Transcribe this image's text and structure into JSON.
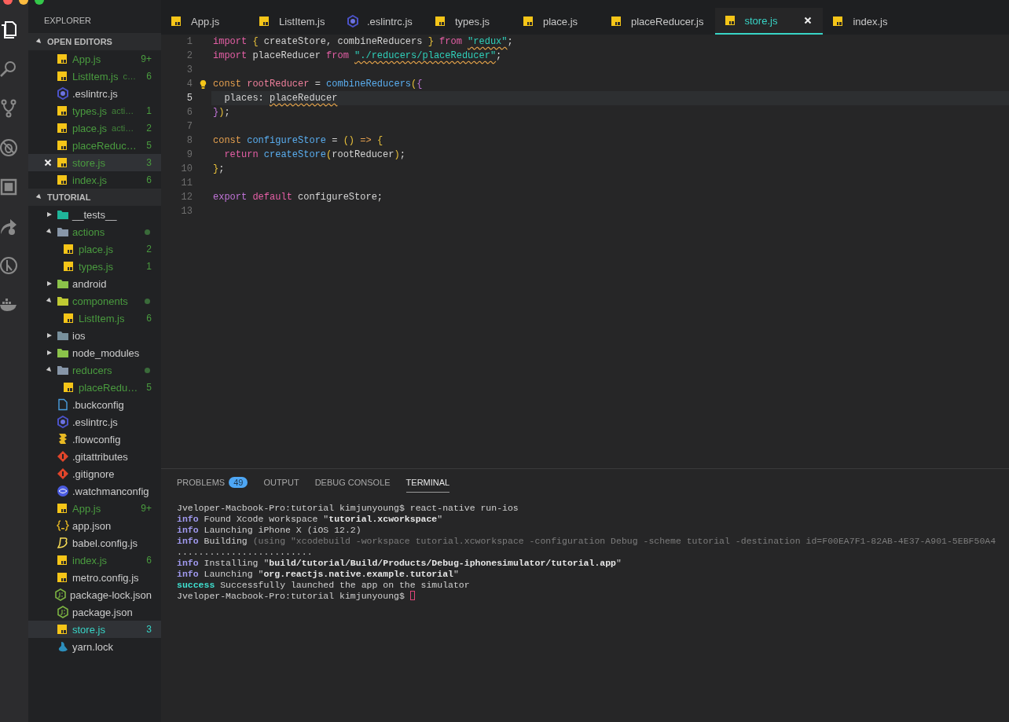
{
  "sidebar": {
    "title": "EXPLORER",
    "open_editors": {
      "title": "OPEN EDITORS",
      "expanded": true,
      "items": [
        {
          "name": "App.js",
          "kind": "js",
          "modified": true,
          "badge": "9+",
          "selected": false
        },
        {
          "name": "ListItem.js",
          "description": "c…",
          "kind": "js",
          "modified": true,
          "badge": "6",
          "selected": false
        },
        {
          "name": ".eslintrc.js",
          "kind": "eslint",
          "modified": false,
          "selected": false
        },
        {
          "name": "types.js",
          "description": "acti…",
          "kind": "js",
          "modified": true,
          "badge": "1",
          "selected": false
        },
        {
          "name": "place.js",
          "description": "acti…",
          "kind": "js",
          "modified": true,
          "badge": "2",
          "selected": false
        },
        {
          "name": "placeReduc…",
          "kind": "js",
          "modified": true,
          "badge": "5",
          "selected": false
        },
        {
          "name": "store.js",
          "kind": "js",
          "modified": true,
          "badge": "3",
          "selected": true
        },
        {
          "name": "index.js",
          "kind": "js",
          "modified": true,
          "badge": "6",
          "selected": false
        }
      ]
    },
    "project": {
      "title": "TUTORIAL",
      "expanded": true,
      "items": [
        {
          "name": "__tests__",
          "kind": "folder-tests",
          "expanded": false,
          "modified": false,
          "selected": false
        },
        {
          "name": "actions",
          "kind": "folder",
          "expanded": true,
          "modified": true,
          "selected": false,
          "children": [
            {
              "name": "place.js",
              "kind": "js",
              "modified": true,
              "badge": "2",
              "selected": false
            },
            {
              "name": "types.js",
              "kind": "js",
              "modified": true,
              "badge": "1",
              "selected": false
            }
          ]
        },
        {
          "name": "android",
          "kind": "folder-android",
          "expanded": false,
          "modified": false,
          "selected": false
        },
        {
          "name": "components",
          "kind": "folder-components",
          "expanded": true,
          "modified": true,
          "selected": false,
          "children": [
            {
              "name": "ListItem.js",
              "kind": "js",
              "modified": true,
              "badge": "6",
              "selected": false
            }
          ]
        },
        {
          "name": "ios",
          "kind": "folder-ios",
          "expanded": false,
          "modified": false,
          "selected": false
        },
        {
          "name": "node_modules",
          "kind": "folder-node",
          "expanded": false,
          "modified": false,
          "selected": false
        },
        {
          "name": "reducers",
          "kind": "folder",
          "expanded": true,
          "modified": true,
          "selected": false,
          "children": [
            {
              "name": "placeRedu…",
              "kind": "js",
              "modified": true,
              "badge": "5",
              "selected": false
            }
          ]
        },
        {
          "name": ".buckconfig",
          "kind": "file",
          "modified": false,
          "selected": false
        },
        {
          "name": ".eslintrc.js",
          "kind": "eslint",
          "modified": false,
          "selected": false
        },
        {
          "name": ".flowconfig",
          "kind": "flow",
          "modified": false,
          "selected": false
        },
        {
          "name": ".gitattributes",
          "kind": "git",
          "modified": false,
          "selected": false
        },
        {
          "name": ".gitignore",
          "kind": "git",
          "modified": false,
          "selected": false
        },
        {
          "name": ".watchmanconfig",
          "kind": "watchman",
          "modified": false,
          "selected": false
        },
        {
          "name": "App.js",
          "kind": "js",
          "modified": true,
          "badge": "9+",
          "selected": false
        },
        {
          "name": "app.json",
          "kind": "json",
          "modified": false,
          "selected": false
        },
        {
          "name": "babel.config.js",
          "kind": "babel",
          "modified": false,
          "selected": false
        },
        {
          "name": "index.js",
          "kind": "js",
          "modified": true,
          "badge": "6",
          "selected": false
        },
        {
          "name": "metro.config.js",
          "kind": "js",
          "modified": false,
          "selected": false
        },
        {
          "name": "package-lock.json",
          "kind": "nodejs",
          "modified": false,
          "selected": false
        },
        {
          "name": "package.json",
          "kind": "nodejs",
          "modified": false,
          "selected": false
        },
        {
          "name": "store.js",
          "kind": "js",
          "modified": true,
          "badge": "3",
          "selected": true
        },
        {
          "name": "yarn.lock",
          "kind": "yarn",
          "modified": false,
          "selected": false
        }
      ]
    }
  },
  "tabs": [
    {
      "label": "App.js",
      "kind": "js",
      "selected": false
    },
    {
      "label": "ListItem.js",
      "kind": "js",
      "selected": false
    },
    {
      "label": ".eslintrc.js",
      "kind": "eslint",
      "selected": false
    },
    {
      "label": "types.js",
      "kind": "js",
      "selected": false
    },
    {
      "label": "place.js",
      "kind": "js",
      "selected": false
    },
    {
      "label": "placeReducer.js",
      "kind": "js",
      "selected": false
    },
    {
      "label": "store.js",
      "kind": "js",
      "selected": true
    },
    {
      "label": "index.js",
      "kind": "js",
      "selected": false
    }
  ],
  "editor": {
    "lines": [
      {
        "number": "1",
        "current": false,
        "tokens": [
          {
            "t": "import",
            "kind": "kw"
          },
          {
            "t": " {",
            "kind": "brace"
          },
          {
            "t": " createStore, combineReducers ",
            "kind": "plain"
          },
          {
            "t": "}",
            "kind": "brace"
          },
          {
            "t": " from ",
            "kind": "kw"
          },
          {
            "t": "\"redux\"",
            "kind": "str",
            "warn": true
          },
          {
            "t": ";",
            "kind": "plain"
          }
        ]
      },
      {
        "number": "2",
        "current": false,
        "tokens": [
          {
            "t": "import",
            "kind": "kw"
          },
          {
            "t": " placeReducer ",
            "kind": "plain"
          },
          {
            "t": "from ",
            "kind": "kw"
          },
          {
            "t": "\"./reducers/placeReducer\"",
            "kind": "str",
            "warn": true
          },
          {
            "t": ";",
            "kind": "plain"
          }
        ]
      },
      {
        "number": "3",
        "current": false
      },
      {
        "number": "4",
        "current": false,
        "bulb": true,
        "tokens": [
          {
            "t": "const ",
            "kind": "storage"
          },
          {
            "t": "rootReducer",
            "kind": "decl"
          },
          {
            "t": " = ",
            "kind": "plain"
          },
          {
            "t": "combineReducers",
            "kind": "fn"
          },
          {
            "t": "(",
            "kind": "brace"
          },
          {
            "t": "{",
            "kind": "export"
          }
        ]
      },
      {
        "number": "5",
        "current": true,
        "tokens": [
          {
            "t": "  places: ",
            "kind": "plain"
          },
          {
            "t": "placeReducer",
            "kind": "plain",
            "warn": true
          }
        ]
      },
      {
        "number": "6",
        "current": false,
        "tokens": [
          {
            "t": "}",
            "kind": "export"
          },
          {
            "t": ")",
            "kind": "brace"
          },
          {
            "t": ";",
            "kind": "plain"
          }
        ]
      },
      {
        "number": "7",
        "current": false
      },
      {
        "number": "8",
        "current": false,
        "tokens": [
          {
            "t": "const ",
            "kind": "storage"
          },
          {
            "t": "configureStore",
            "kind": "fn"
          },
          {
            "t": " = ",
            "kind": "plain"
          },
          {
            "t": "()",
            "kind": "brace"
          },
          {
            "t": " => ",
            "kind": "storage"
          },
          {
            "t": "{",
            "kind": "brace"
          }
        ]
      },
      {
        "number": "9",
        "current": false,
        "tokens": [
          {
            "t": "  return ",
            "kind": "kw"
          },
          {
            "t": "createStore",
            "kind": "fn"
          },
          {
            "t": "(",
            "kind": "brace"
          },
          {
            "t": "rootReducer",
            "kind": "plain"
          },
          {
            "t": ")",
            "kind": "brace"
          },
          {
            "t": ";",
            "kind": "plain"
          }
        ]
      },
      {
        "number": "10",
        "current": false,
        "tokens": [
          {
            "t": "}",
            "kind": "brace"
          },
          {
            "t": ";",
            "kind": "plain"
          }
        ]
      },
      {
        "number": "11",
        "current": false
      },
      {
        "number": "12",
        "current": false,
        "tokens": [
          {
            "t": "export",
            "kind": "export"
          },
          {
            "t": " default ",
            "kind": "kw"
          },
          {
            "t": "configureStore;",
            "kind": "plain"
          }
        ]
      },
      {
        "number": "13",
        "current": false
      }
    ]
  },
  "panel": {
    "tabs": [
      {
        "label": "PROBLEMS",
        "badge": "49",
        "selected": false
      },
      {
        "label": "OUTPUT",
        "selected": false
      },
      {
        "label": "DEBUG CONSOLE",
        "selected": false
      },
      {
        "label": "TERMINAL",
        "selected": true
      }
    ],
    "terminal": [
      {
        "cursor": false,
        "segments": [
          {
            "t": "Jveloper-Macbook-Pro:tutorial kimjunyoung$ react-native run-ios",
            "kind": "plain"
          }
        ]
      },
      {
        "cursor": false,
        "segments": [
          {
            "t": "info",
            "kind": "info"
          },
          {
            "t": " Found Xcode workspace \"",
            "kind": "plain"
          },
          {
            "t": "tutorial.xcworkspace",
            "kind": "bold"
          },
          {
            "t": "\"",
            "kind": "plain"
          }
        ]
      },
      {
        "cursor": false,
        "segments": [
          {
            "t": "info",
            "kind": "info"
          },
          {
            "t": " Launching iPhone X (iOS 12.2)",
            "kind": "plain"
          }
        ]
      },
      {
        "cursor": false,
        "segments": [
          {
            "t": "info",
            "kind": "info"
          },
          {
            "t": " Building ",
            "kind": "plain"
          },
          {
            "t": "(using \"xcodebuild -workspace tutorial.xcworkspace -configuration Debug -scheme tutorial -destination id=F00EA7F1-82AB-4E37-A901-5EBF50A4",
            "kind": "dim"
          }
        ]
      },
      {
        "cursor": false,
        "segments": [
          {
            "t": ".........................",
            "kind": "plain"
          }
        ]
      },
      {
        "cursor": false,
        "segments": [
          {
            "t": "info",
            "kind": "info"
          },
          {
            "t": " Installing \"",
            "kind": "plain"
          },
          {
            "t": "build/tutorial/Build/Products/Debug-iphonesimulator/tutorial.app",
            "kind": "bold"
          },
          {
            "t": "\"",
            "kind": "plain"
          }
        ]
      },
      {
        "cursor": false,
        "segments": [
          {
            "t": "info",
            "kind": "info"
          },
          {
            "t": " Launching \"",
            "kind": "plain"
          },
          {
            "t": "org.reactjs.native.example.tutorial",
            "kind": "bold"
          },
          {
            "t": "\"",
            "kind": "plain"
          }
        ]
      },
      {
        "cursor": false,
        "segments": [
          {
            "t": "success",
            "kind": "success"
          },
          {
            "t": " Successfully launched the app on the simulator",
            "kind": "plain"
          }
        ]
      },
      {
        "cursor": true,
        "segments": [
          {
            "t": "Jveloper-Macbook-Pro:tutorial kimjunyoung$ ",
            "kind": "plain"
          }
        ]
      }
    ]
  }
}
